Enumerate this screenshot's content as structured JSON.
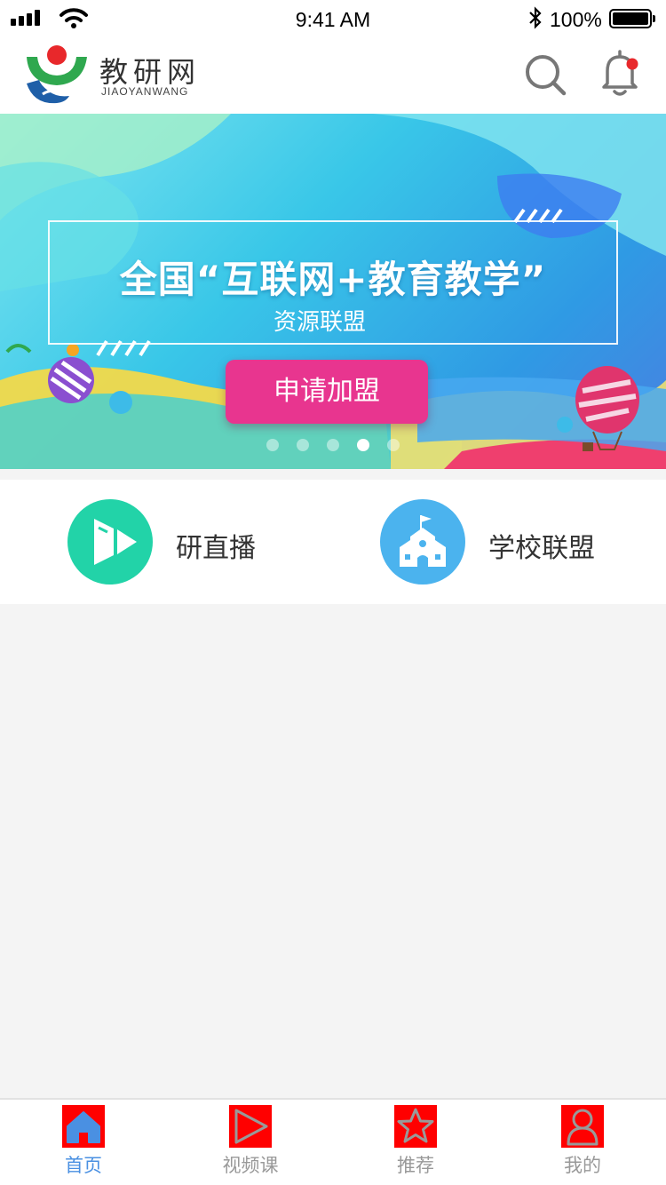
{
  "status_bar": {
    "time": "9:41 AM",
    "battery_percent": "100%",
    "icons": [
      "signal-icon",
      "wifi-icon",
      "bluetooth-icon",
      "battery-icon"
    ]
  },
  "header": {
    "logo_cn": "教研网",
    "logo_en": "JIAOYANWANG",
    "actions": [
      "search-icon",
      "bell-icon"
    ],
    "notification_dot_color": "#e8282b"
  },
  "banner": {
    "title": "全国“互联网+教育教学”",
    "subtitle": "资源联盟",
    "cta_label": "申请加盟",
    "cta_color": "#e8358f",
    "slide_count": 5,
    "active_slide": 4
  },
  "quick_entries": [
    {
      "label": "研直播",
      "icon": "live-play-icon",
      "color": "#22d3a8"
    },
    {
      "label": "学校联盟",
      "icon": "school-icon",
      "color": "#4bb3ee"
    }
  ],
  "tab_bar": {
    "active_color": "#4a90e2",
    "inactive_color": "#999999",
    "tabs": [
      {
        "label": "首页",
        "icon": "home-icon",
        "active": true
      },
      {
        "label": "视频课",
        "icon": "play-icon",
        "active": false
      },
      {
        "label": "推荐",
        "icon": "star-icon",
        "active": false
      },
      {
        "label": "我的",
        "icon": "user-icon",
        "active": false
      }
    ]
  }
}
